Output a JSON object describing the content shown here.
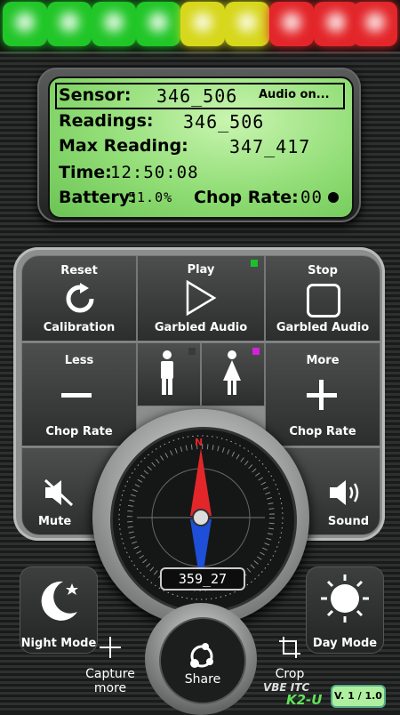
{
  "colors": {
    "led_green": "#21c628",
    "led_yellow": "#d7d71c",
    "led_red": "#e3262a",
    "indicator_green": "#19c22b",
    "indicator_magenta": "#d521d8",
    "indicator_dark": "#3a3a3a"
  },
  "lights": [
    "green",
    "green",
    "green",
    "green",
    "yellow",
    "yellow",
    "red",
    "red",
    "red"
  ],
  "lcd": {
    "sensor_label": "Sensor:",
    "sensor_value": "346_506",
    "audio_status": "Audio on...",
    "readings_label": "Readings:",
    "readings_value": "346_506",
    "max_label": "Max Reading:",
    "max_value": "347_417",
    "time_label": "Time:",
    "time_value": "12:50:08",
    "battery_label": "Battery:",
    "battery_value": "51.0%",
    "chop_label": "Chop Rate:",
    "chop_value": "00"
  },
  "buttons": {
    "reset_top": "Reset",
    "reset_bottom": "Calibration",
    "play_top": "Play",
    "play_bottom": "Garbled Audio",
    "stop_top": "Stop",
    "stop_bottom": "Garbled Audio",
    "less_top": "Less",
    "less_bottom": "Chop Rate",
    "more_top": "More",
    "more_bottom": "Chop Rate",
    "mute": "Mute",
    "sound": "Sound"
  },
  "compass": {
    "north": "N",
    "readout": "359_27"
  },
  "bottom": {
    "night_mode": "Night Mode",
    "day_mode": "Day Mode",
    "capture_line1": "Capture",
    "capture_line2": "more",
    "share": "Share",
    "crop": "Crop",
    "brand_line1": "VBE ITC",
    "brand_line2": "K2-U",
    "version": "V. 1 / 1.0"
  }
}
